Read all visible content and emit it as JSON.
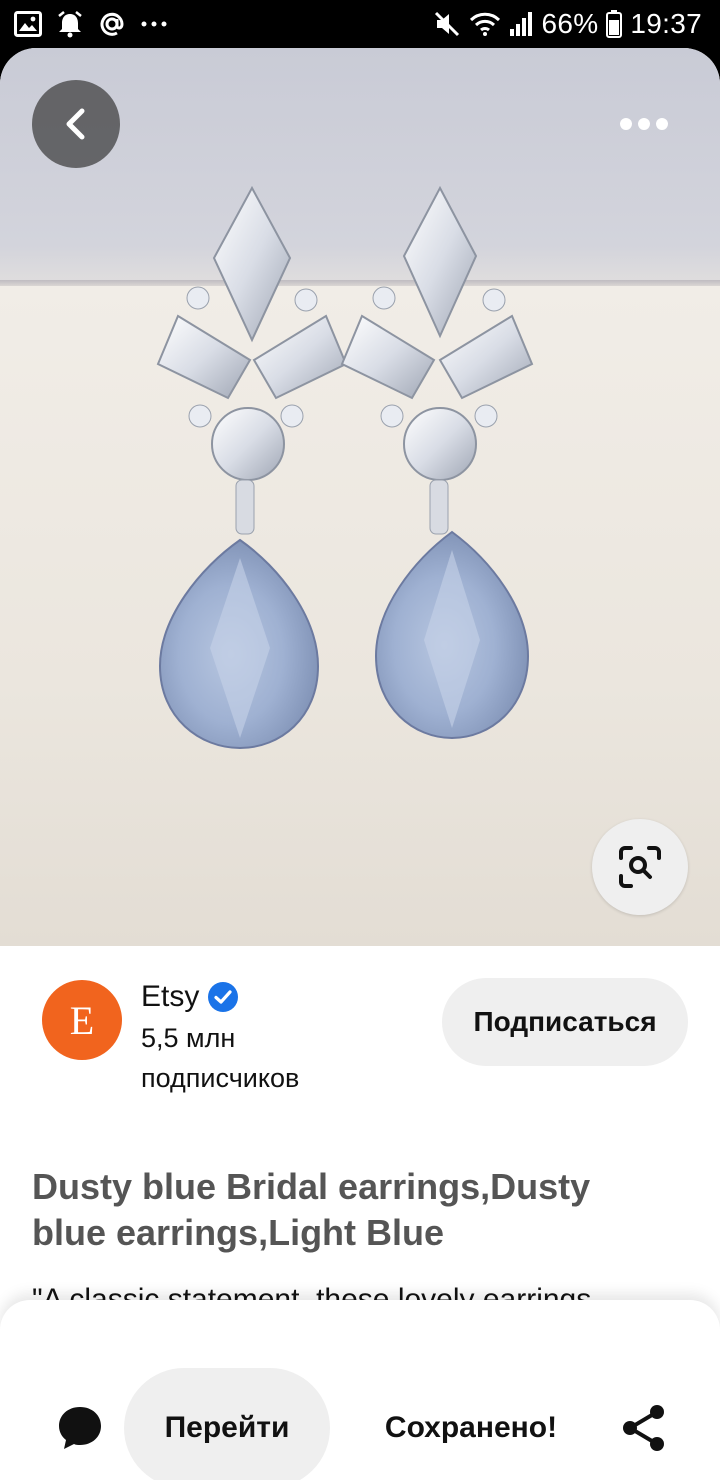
{
  "status_bar": {
    "battery": "66%",
    "time": "19:37",
    "left_icons": [
      "gallery-icon",
      "alarm-icon",
      "at-icon",
      "more-dots-icon"
    ],
    "right_icons": [
      "mute-icon",
      "wifi-icon",
      "signal-icon",
      "battery-icon"
    ]
  },
  "pin": {
    "image_alt": "Dusty blue crystal teardrop earrings",
    "creator": {
      "avatar_letter": "E",
      "name": "Etsy",
      "verified": true,
      "followers": "5,5 млн подписчиков",
      "follow_label": "Подписаться"
    },
    "title": "Dusty blue Bridal earrings,Dusty blue earrings,Light Blue",
    "description": "\"A classic statement, these lovely earrings"
  },
  "actions": {
    "go_label": "Перейти",
    "saved_label": "Сохранено!"
  },
  "colors": {
    "brand": "#f1641e",
    "verified": "#1a73e8",
    "button_bg": "#efefef"
  }
}
